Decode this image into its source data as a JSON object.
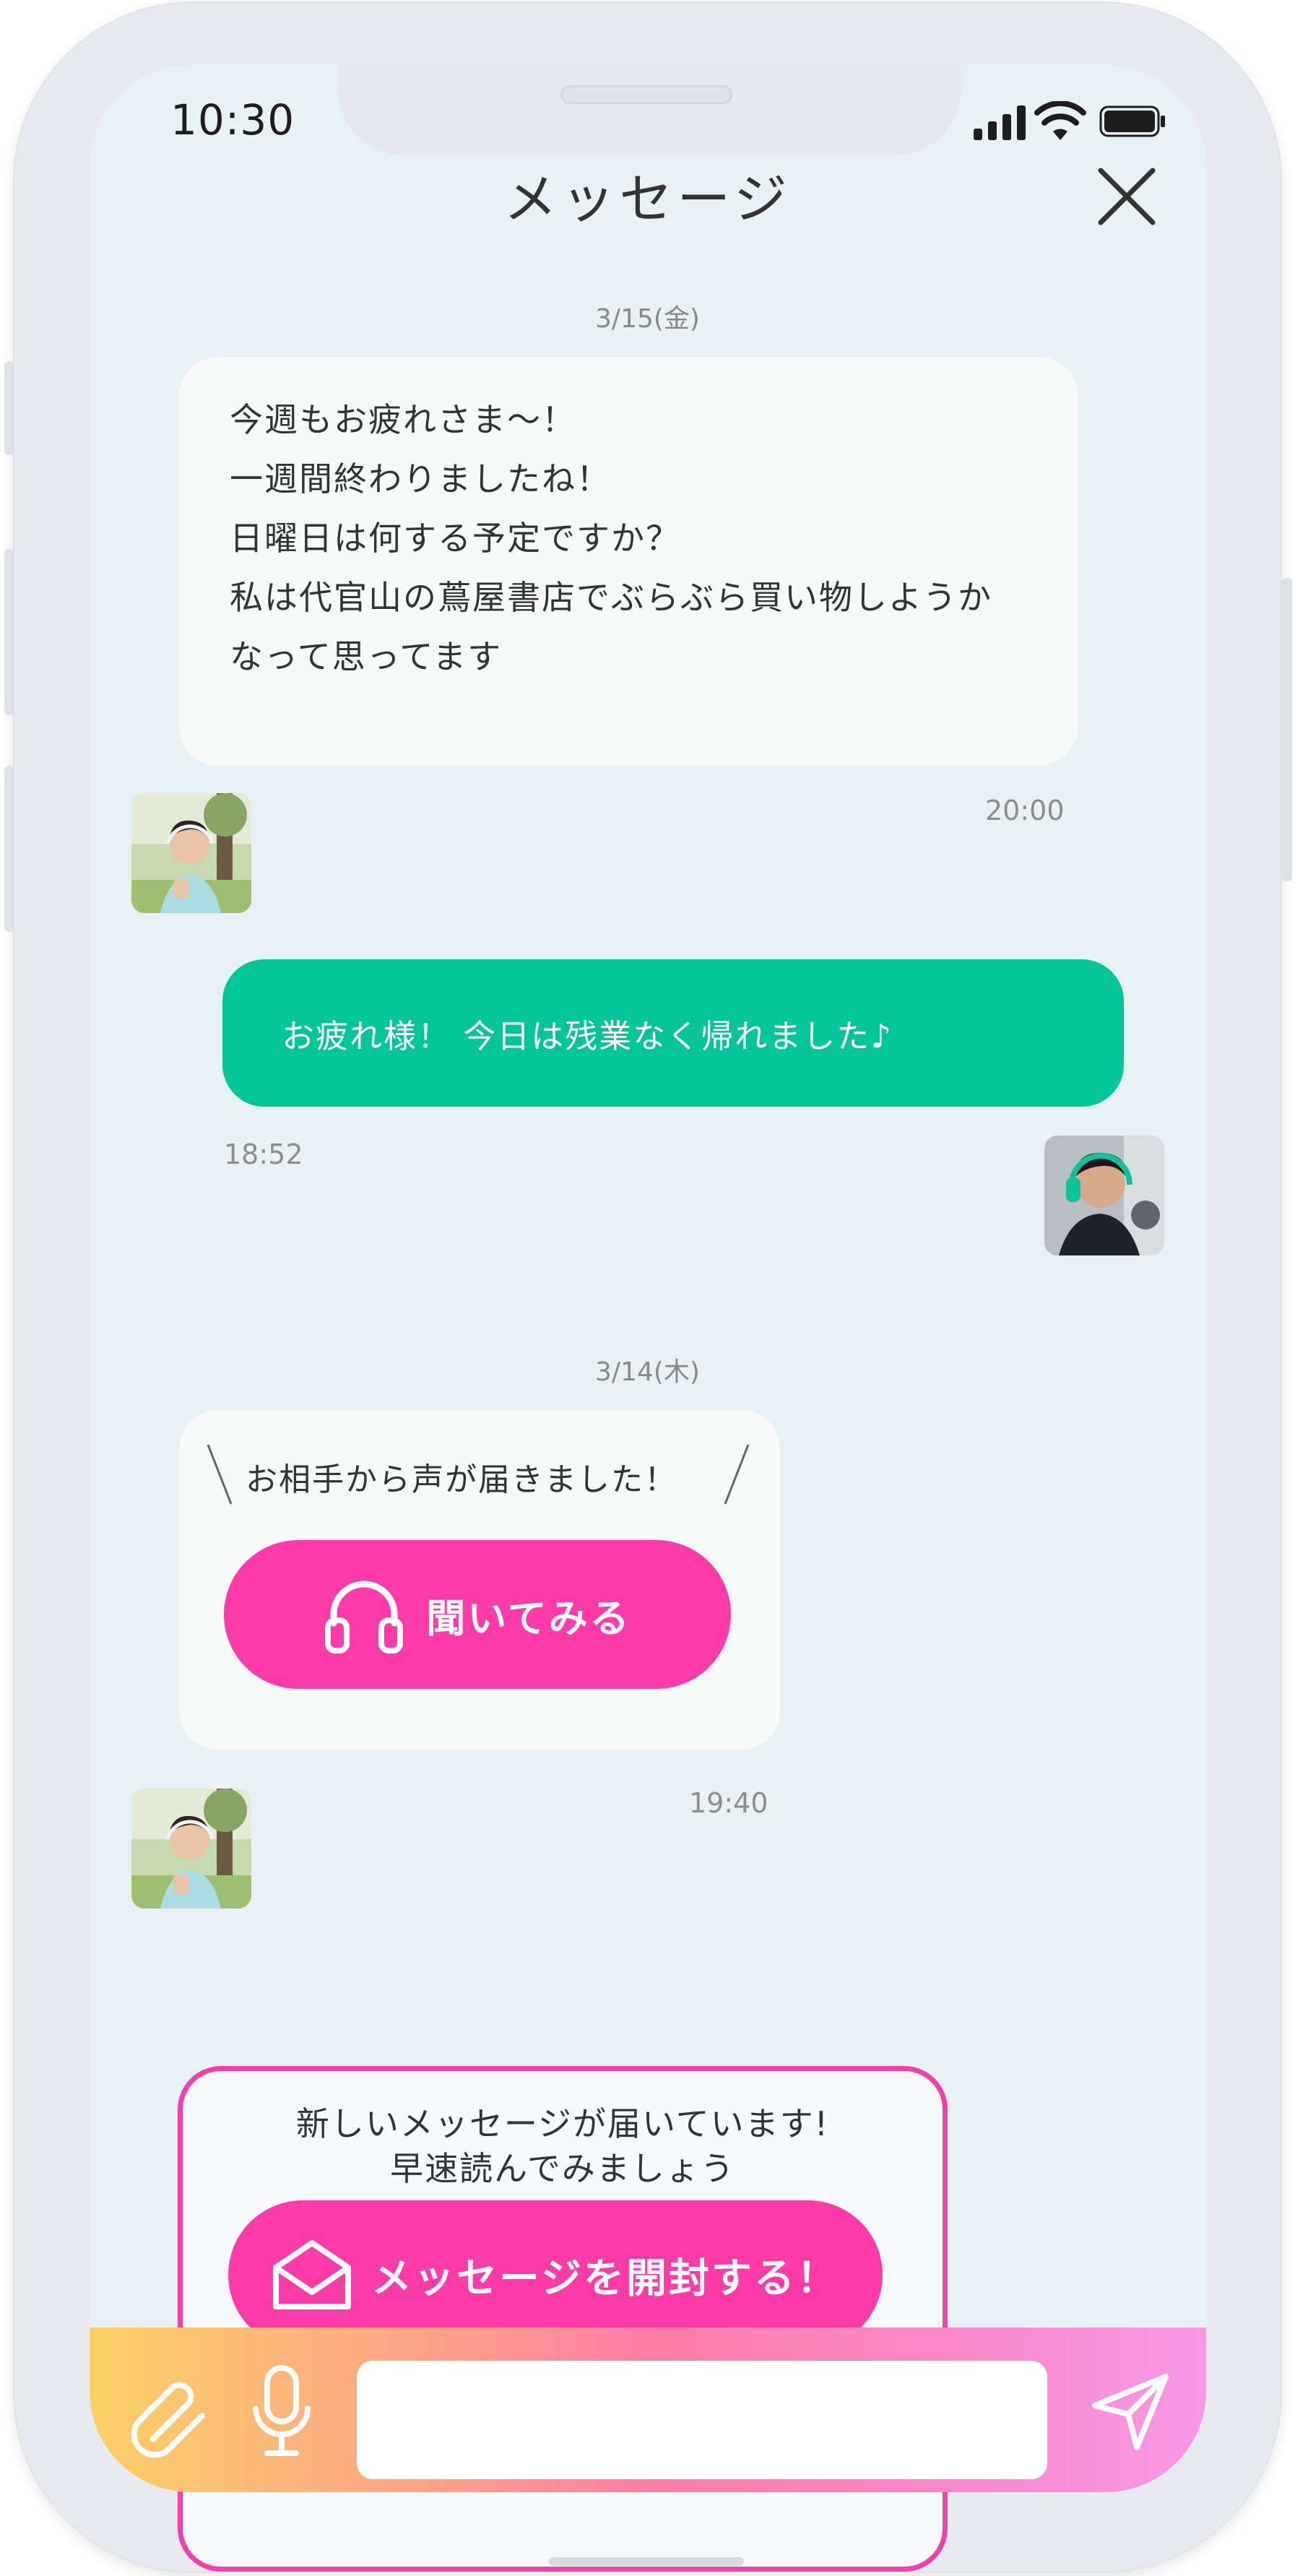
{
  "status_bar": {
    "time": "10:30"
  },
  "header": {
    "title": "メッセージ",
    "close_icon": "close-icon"
  },
  "messages": {
    "date1": "3/15(金)",
    "received1": {
      "lines": [
        "今週もお疲れさま〜！",
        "一週間終わりましたね！",
        "日曜日は何する予定ですか？",
        "私は代官山の蔦屋書店でぶらぶら買い物しようか",
        "なって思ってます"
      ],
      "time": "20:00"
    },
    "sent1": {
      "text": "お疲れ様！ 今日は残業なく帰れました♪",
      "time": "18:52"
    },
    "date2": "3/14(木)",
    "voice": {
      "notice": "お相手から声が届きました！",
      "button_label": "聞いてみる",
      "time": "19:40"
    },
    "new_message": {
      "line1": "新しいメッセージが届いています!",
      "line2": "早速読んでみましょう",
      "button_label": "メッセージを開封する！"
    }
  },
  "input": {
    "placeholder": ""
  },
  "colors": {
    "accent_green": "#02c598",
    "accent_pink": "#fd3ba8",
    "background": "#e8f1f3"
  }
}
